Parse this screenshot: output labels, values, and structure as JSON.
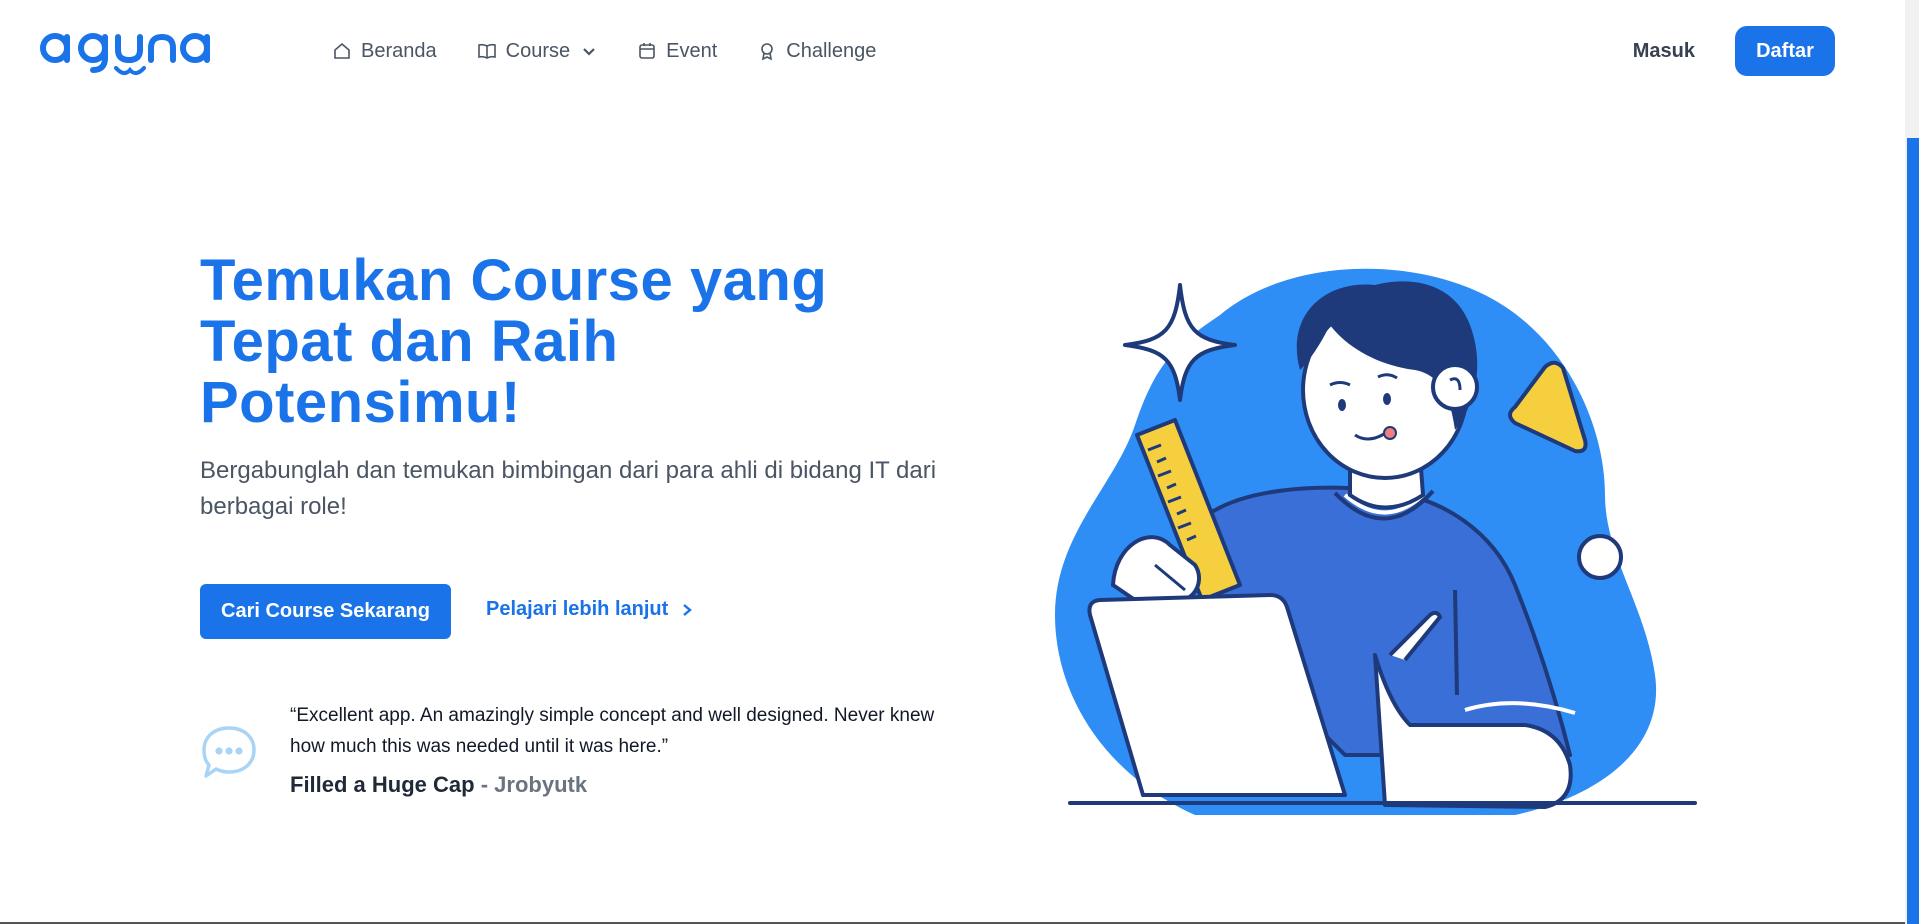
{
  "brand": {
    "logo_text": "aguna",
    "accent_color": "#1a73e8"
  },
  "nav": {
    "items": [
      {
        "label": "Beranda",
        "icon": "home-icon"
      },
      {
        "label": "Course",
        "icon": "book-icon",
        "dropdown": true
      },
      {
        "label": "Event",
        "icon": "calendar-icon"
      },
      {
        "label": "Challenge",
        "icon": "award-icon"
      }
    ]
  },
  "auth": {
    "login_label": "Masuk",
    "register_label": "Daftar"
  },
  "hero": {
    "title": "Temukan Course yang Tepat dan Raih Potensimu!",
    "subtitle": "Bergabunglah dan temukan bimbingan dari para ahli di bidang IT dari berbagai role!",
    "primary_cta": "Cari Course Sekarang",
    "secondary_cta": "Pelajari lebih lanjut"
  },
  "testimonial": {
    "quote": "“Excellent app. An amazingly simple concept and well designed. Never knew how much this was needed until it was here.”",
    "title": "Filled a Huge Cap",
    "separator": " - ",
    "author": "Jrobyutk"
  }
}
